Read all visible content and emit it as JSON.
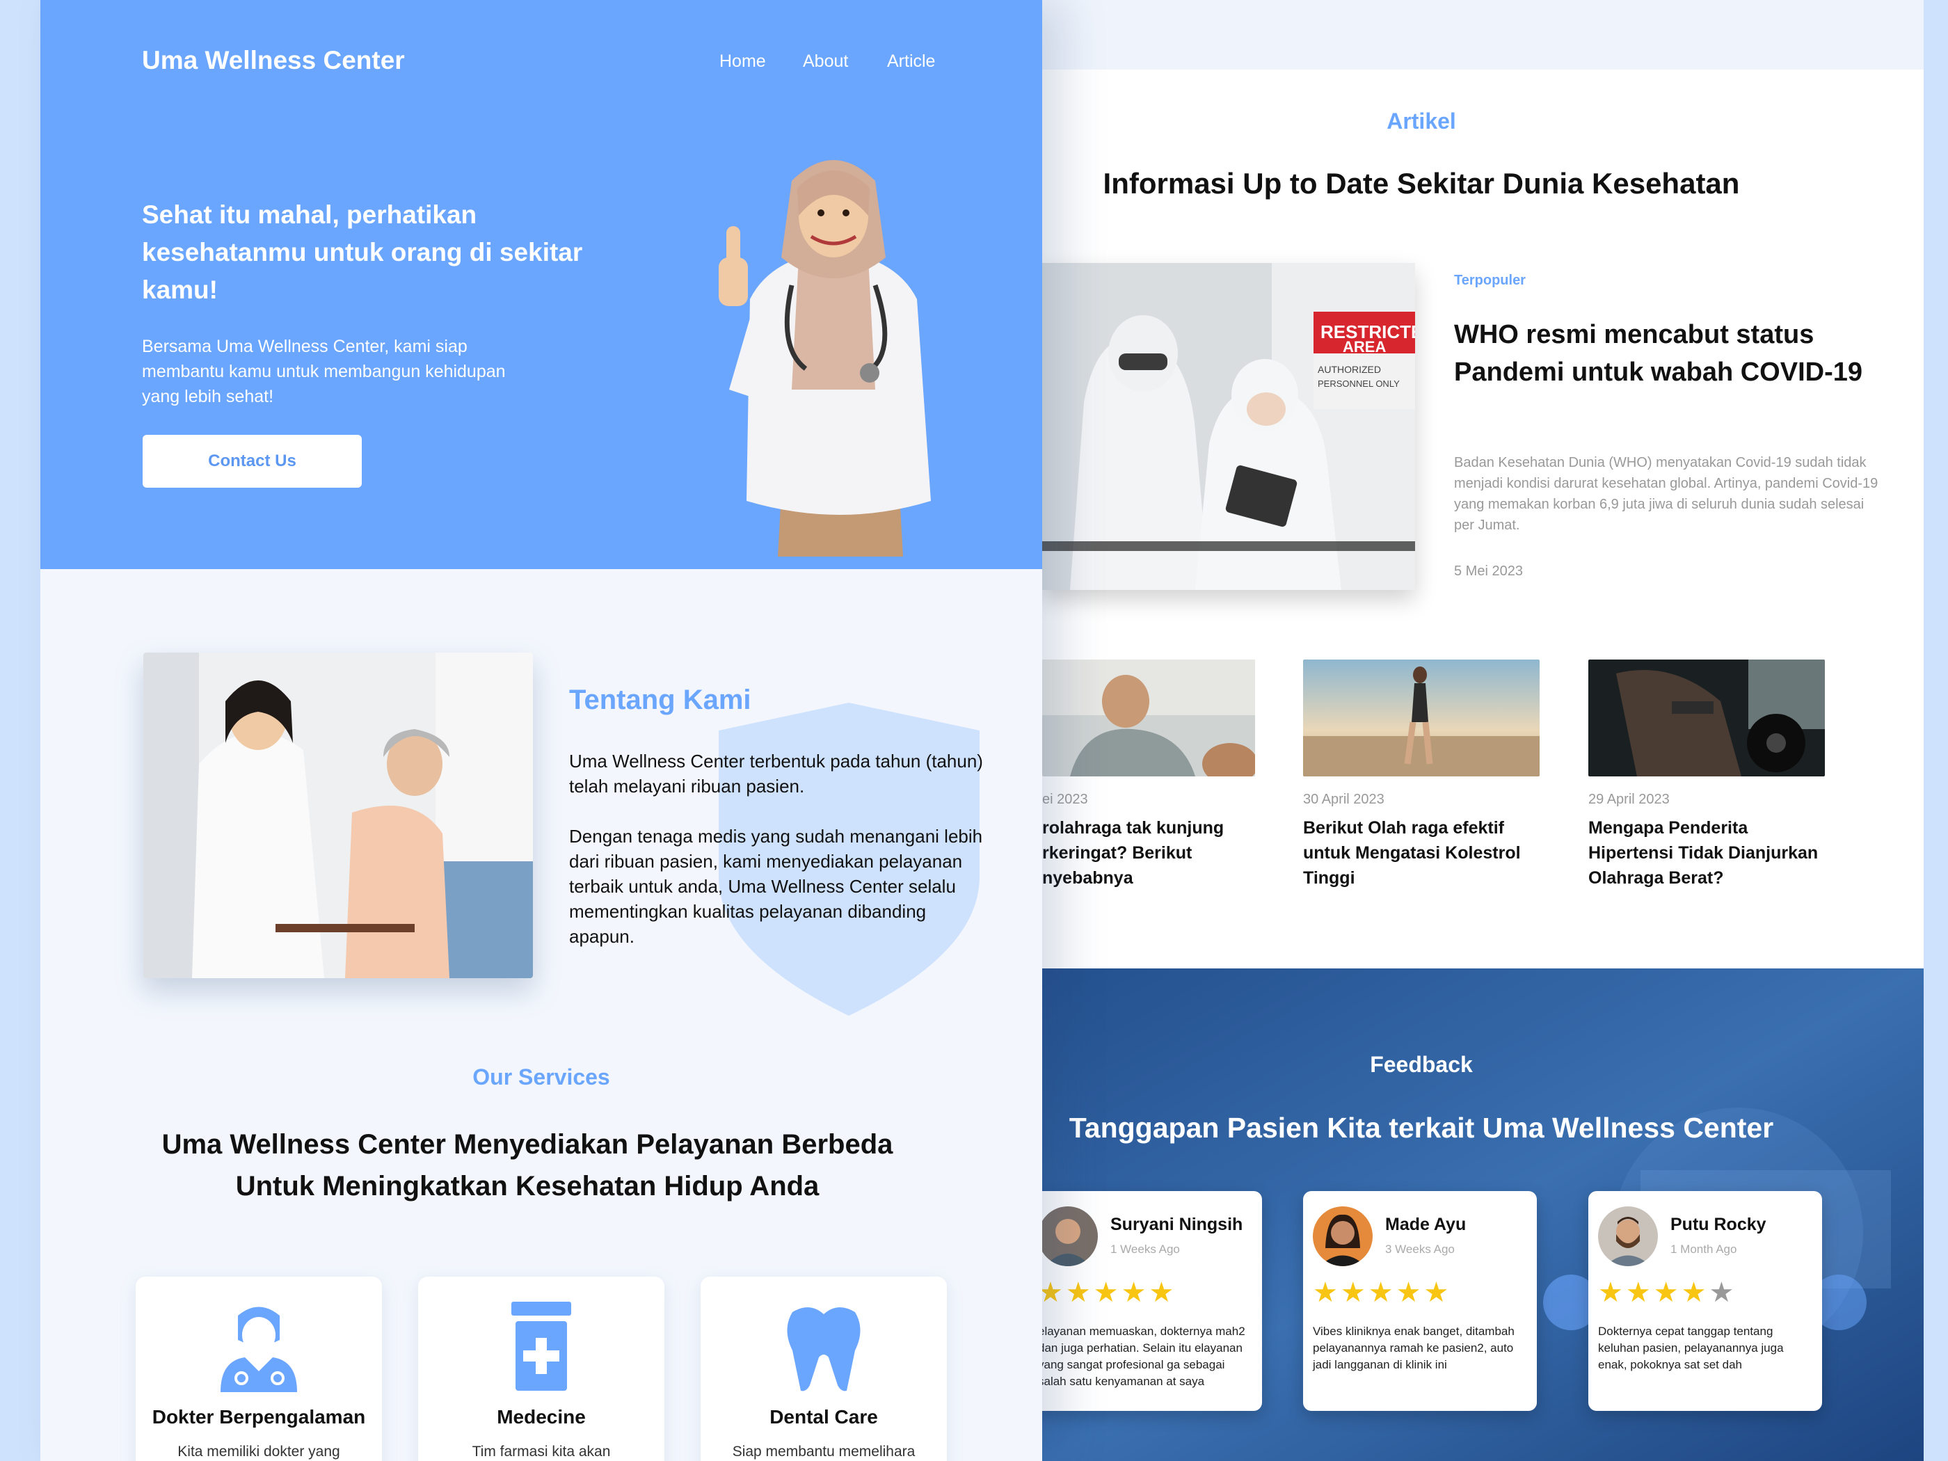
{
  "hero": {
    "brand": "Uma Wellness Center",
    "nav": [
      "Home",
      "About",
      "Article"
    ],
    "title": "Sehat itu mahal, perhatikan kesehatanmu untuk orang di sekitar kamu!",
    "subtitle": "Bersama Uma Wellness Center, kami siap membantu kamu untuk membangun kehidupan yang lebih sehat!",
    "cta": "Contact Us"
  },
  "about": {
    "heading": "Tentang Kami",
    "p1": "Uma Wellness Center terbentuk pada tahun (tahun) telah melayani ribuan pasien.",
    "p2": "Dengan tenaga medis yang sudah menangani lebih dari ribuan pasien, kami menyediakan pelayanan terbaik untuk anda, Uma Wellness Center selalu mementingkan kualitas pelayanan dibanding apapun."
  },
  "services": {
    "label": "Our Services",
    "title": "Uma Wellness Center Menyediakan Pelayanan Berbeda Untuk Meningkatkan Kesehatan Hidup Anda",
    "cards": [
      {
        "title": "Dokter Berpengalaman",
        "desc": "Kita memiliki dokter yang",
        "icon": "doctor-icon"
      },
      {
        "title": "Medecine",
        "desc": "Tim farmasi kita akan",
        "icon": "medicine-bottle-icon"
      },
      {
        "title": "Dental Care",
        "desc": "Siap membantu memelihara",
        "icon": "tooth-icon"
      }
    ]
  },
  "articles": {
    "label": "Artikel",
    "title": "Informasi Up to Date Sekitar Dunia Kesehatan",
    "featured": {
      "tag": "Terpopuler",
      "title": "WHO resmi mencabut status Pandemi untuk wabah COVID-19",
      "excerpt": "Badan Kesehatan Dunia (WHO) menyatakan Covid-19 sudah tidak menjadi kondisi darurat kesehatan global. Artinya, pandemi Covid-19 yang memakan korban 6,9 juta jiwa di seluruh dunia sudah selesai per Jumat.",
      "date": "5 Mei 2023",
      "sign_line1": "RESTRICTED",
      "sign_line2": "AREA",
      "sign_line3": "AUTHORIZED",
      "sign_line4": "PERSONNEL ONLY"
    },
    "items": [
      {
        "date": "ei 2023",
        "title": "rolahraga tak kunjung rkeringat? Berikut nyebabnya"
      },
      {
        "date": "30 April 2023",
        "title": "Berikut Olah raga efektif untuk Mengatasi Kolestrol Tinggi"
      },
      {
        "date": "29 April 2023",
        "title": "Mengapa Penderita Hipertensi Tidak Dianjurkan Olahraga Berat?"
      }
    ]
  },
  "feedback": {
    "label": "Feedback",
    "title": "Tanggapan Pasien Kita terkait Uma Wellness Center",
    "reviews": [
      {
        "name": "Suryani Ningsih",
        "time": "1 Weeks Ago",
        "rating": 5,
        "text": "elayanan memuaskan, dokternya mah2 dan juga perhatian. Selain itu elayanan yang sangat profesional ga sebagai salah satu kenyamanan at saya"
      },
      {
        "name": "Made Ayu",
        "time": "3 Weeks Ago",
        "rating": 5,
        "text": "Vibes kliniknya enak banget, ditambah pelayanannya ramah ke pasien2, auto jadi langganan di klinik ini"
      },
      {
        "name": "Putu Rocky",
        "time": "1 Month Ago",
        "rating": 4,
        "text": "Dokternya cepat tanggap tentang keluhan pasien, pelayanannya juga enak, pokoknya sat set dah"
      }
    ]
  },
  "colors": {
    "accent": "#6aa5fe",
    "star": "#f9c513",
    "star_empty": "#999999",
    "feedback_bg": "#2f5e9e"
  }
}
